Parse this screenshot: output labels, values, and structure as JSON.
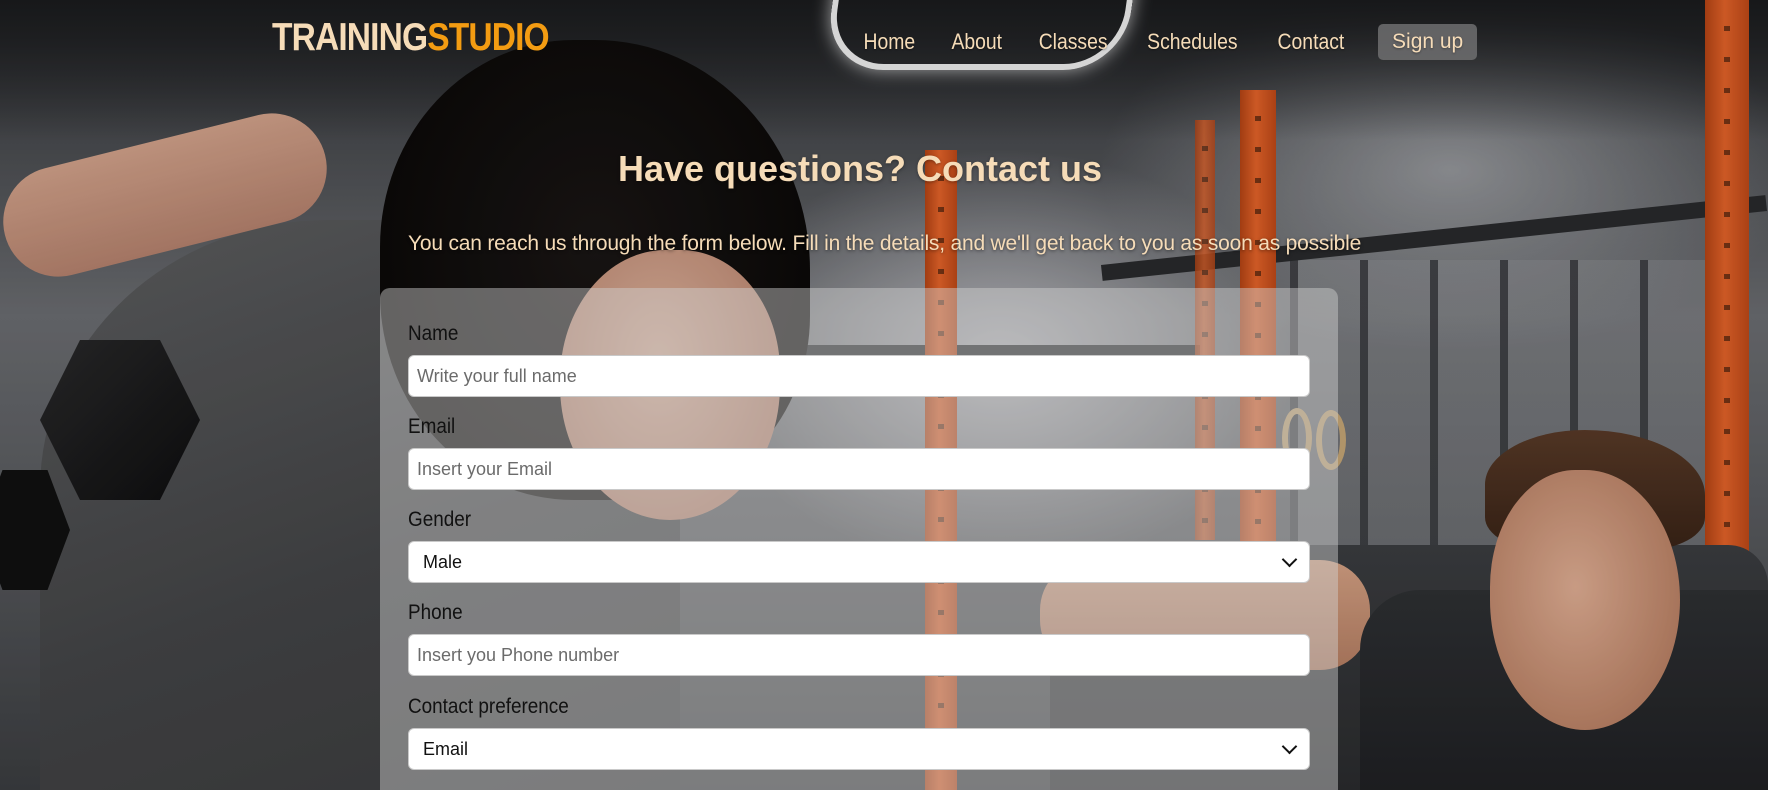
{
  "brand": {
    "part1": "TRAINING",
    "part2": "STUDIO",
    "accent": "#f39c12",
    "text_color": "#f6dcb8"
  },
  "nav": {
    "items": [
      "Home",
      "About",
      "Classes",
      "Schedules",
      "Contact"
    ],
    "signup": "Sign up"
  },
  "hero": {
    "title": "Have questions? Contact us",
    "subtitle": "You can reach us through the form below. Fill in the details, and we'll get back to you as soon as possible"
  },
  "form": {
    "name": {
      "label": "Name",
      "placeholder": "Write your full name"
    },
    "email": {
      "label": "Email",
      "placeholder": "Insert your Email"
    },
    "gender": {
      "label": "Gender",
      "selected": "Male"
    },
    "phone": {
      "label": "Phone",
      "placeholder": "Insert you Phone number"
    },
    "contact_pref": {
      "label": "Contact preference",
      "selected": "Email"
    }
  }
}
